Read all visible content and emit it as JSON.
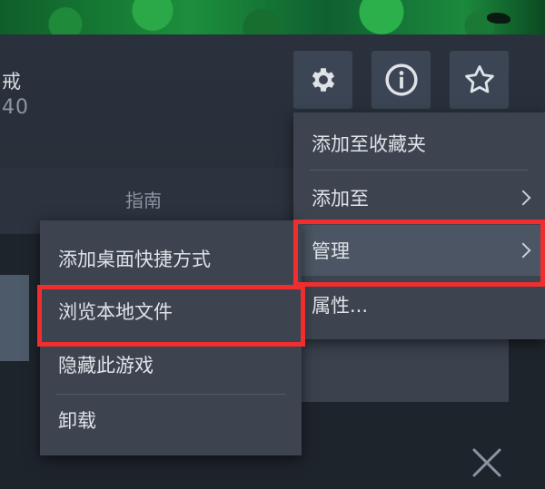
{
  "game": {
    "title_fragment": "戒",
    "subtitle_fragment": "40"
  },
  "tabs": {
    "guide": "指南"
  },
  "icons": {
    "settings": "gear-icon",
    "info": "info-icon",
    "favorite": "star-icon",
    "close": "close-icon"
  },
  "context_menu": {
    "items": [
      {
        "label": "添加至收藏夹",
        "has_submenu": false
      },
      {
        "label": "添加至",
        "has_submenu": true
      },
      {
        "label": "管理",
        "has_submenu": true,
        "active": true
      },
      {
        "label": "属性...",
        "has_submenu": false
      }
    ]
  },
  "manage_submenu": {
    "items": [
      {
        "label": "添加桌面快捷方式"
      },
      {
        "label": "浏览本地文件",
        "highlighted": true
      },
      {
        "label": "隐藏此游戏"
      },
      {
        "label": "卸载"
      }
    ]
  },
  "colors": {
    "panel_bg": "#2a313c",
    "menu_bg": "#3d4450",
    "menu_active": "#4b5563",
    "highlight_border": "#f02e2e",
    "text": "#dfe3e8"
  }
}
